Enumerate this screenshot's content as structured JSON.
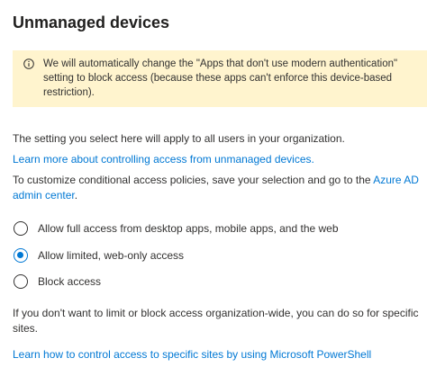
{
  "page": {
    "title": "Unmanaged devices"
  },
  "warning": {
    "icon": "info-icon",
    "text": "We will automatically change the \"Apps that don't use modern authentication\" setting to block access (because these apps can't enforce this device-based restriction)."
  },
  "description": {
    "setting_text": "The setting you select here will apply to all users in your organization.",
    "learn_more_link": "Learn more about controlling access from unmanaged devices.",
    "conditional_text": "To customize conditional access policies, save your selection and go to the ",
    "azure_link": "Azure AD admin center",
    "conditional_end": "."
  },
  "options": {
    "selected_index": 1,
    "items": [
      {
        "label": "Allow full access from desktop apps, mobile apps, and the web",
        "selected": false
      },
      {
        "label": "Allow limited, web-only access",
        "selected": true
      },
      {
        "label": "Block access",
        "selected": false
      }
    ]
  },
  "footer": {
    "specific_sites_text": "If you don't want to limit or block access organization-wide, you can do so for specific sites.",
    "powershell_link": "Learn how to control access to specific sites by using Microsoft PowerShell"
  },
  "colors": {
    "accent": "#0078d4",
    "warning_background": "#fff4ce",
    "text": "#323130"
  }
}
